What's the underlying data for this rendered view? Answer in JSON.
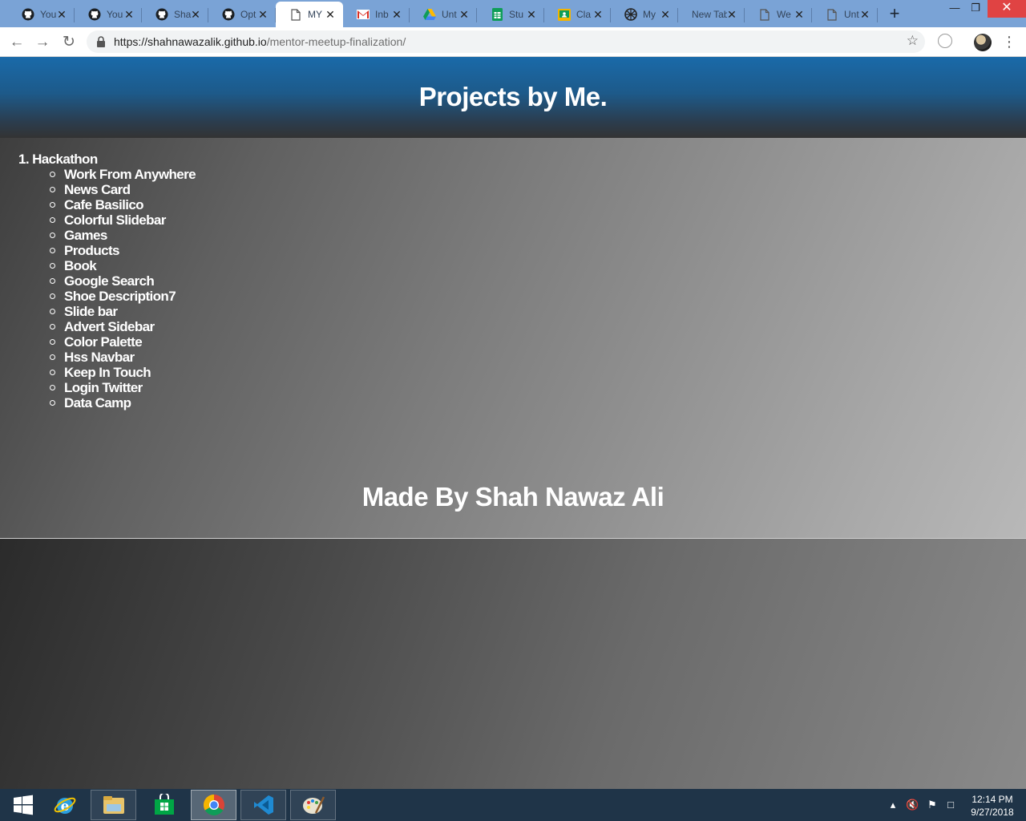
{
  "browser": {
    "tabs": [
      {
        "title": "You",
        "icon": "github-icon"
      },
      {
        "title": "You",
        "icon": "github-icon"
      },
      {
        "title": "Sha",
        "icon": "github-icon"
      },
      {
        "title": "Opt",
        "icon": "github-icon"
      },
      {
        "title": "MY",
        "icon": "page-icon",
        "active": true
      },
      {
        "title": "Inb",
        "icon": "gmail-icon"
      },
      {
        "title": "Unt",
        "icon": "google-drive-icon"
      },
      {
        "title": "Stu",
        "icon": "google-sheets-icon"
      },
      {
        "title": "Cla",
        "icon": "google-classroom-icon"
      },
      {
        "title": "My",
        "icon": "globe-icon"
      },
      {
        "title": "New Tab",
        "icon": "none"
      },
      {
        "title": "We",
        "icon": "page-icon"
      },
      {
        "title": "Unt",
        "icon": "page-icon"
      }
    ],
    "url_host": "https://shahnawazalik.github.io",
    "url_path": "/mentor-meetup-finalization/"
  },
  "page": {
    "title": "Projects by Me.",
    "section_label": "1. Hackathon",
    "projects": [
      "Work From Anywhere",
      "News Card",
      "Cafe Basilico",
      "Colorful Slidebar",
      "Games",
      "Products",
      "Book",
      "Google Search",
      "Shoe Description7",
      "Slide bar",
      "Advert Sidebar",
      "Color Palette",
      "Hss Navbar",
      "Keep In Touch",
      "Login Twitter",
      "Data Camp"
    ],
    "footer": "Made By Shah Nawaz Ali"
  },
  "taskbar": {
    "apps": [
      "windows-start-icon",
      "internet-explorer-icon",
      "file-explorer-icon",
      "store-icon",
      "chrome-icon",
      "vscode-icon",
      "paint-icon"
    ],
    "time": "12:14 PM",
    "date": "9/27/2018"
  }
}
